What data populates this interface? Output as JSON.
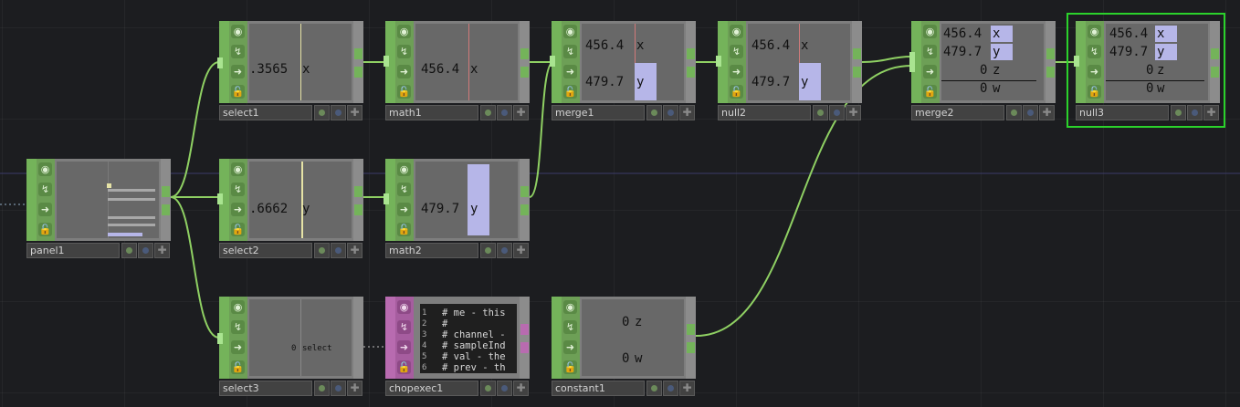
{
  "colors": {
    "background": "#1c1d20",
    "chop_node": "#74b35a",
    "dat_node": "#b86bb0",
    "wire": "#8fd063",
    "selection": "#2bd22b",
    "channel_bar": "#b6b6e8"
  },
  "node_ctrl_icons": [
    "viewer-toggle-icon",
    "bypass-icon",
    "cook-arrow-icon",
    "lock-icon"
  ],
  "nodes": {
    "select1": {
      "label": "select1",
      "value": ".3565",
      "channel": "x"
    },
    "math1": {
      "label": "math1",
      "value": "456.4",
      "channel": "x"
    },
    "merge1": {
      "label": "merge1",
      "rows": [
        {
          "value": "456.4",
          "channel": "x"
        },
        {
          "value": "479.7",
          "channel": "y"
        }
      ]
    },
    "null2": {
      "label": "null2",
      "rows": [
        {
          "value": "456.4",
          "channel": "x"
        },
        {
          "value": "479.7",
          "channel": "y"
        }
      ]
    },
    "merge2": {
      "label": "merge2",
      "rows": [
        {
          "value": "456.4",
          "channel": "x"
        },
        {
          "value": "479.7",
          "channel": "y"
        },
        {
          "value": "0",
          "channel": "z"
        },
        {
          "value": "0",
          "channel": "w"
        }
      ]
    },
    "null3": {
      "label": "null3",
      "rows": [
        {
          "value": "456.4",
          "channel": "x"
        },
        {
          "value": "479.7",
          "channel": "y"
        },
        {
          "value": "0",
          "channel": "z"
        },
        {
          "value": "0",
          "channel": "w"
        }
      ]
    },
    "panel1": {
      "label": "panel1"
    },
    "select2": {
      "label": "select2",
      "value": ".6662",
      "channel": "y"
    },
    "math2": {
      "label": "math2",
      "value": "479.7",
      "channel": "y"
    },
    "select3": {
      "label": "select3",
      "value": "0",
      "channel": "select"
    },
    "chopexec1": {
      "label": "chopexec1",
      "code": [
        {
          "n": "1",
          "text": "# me - this"
        },
        {
          "n": "2",
          "text": "#"
        },
        {
          "n": "3",
          "text": "# channel -"
        },
        {
          "n": "4",
          "text": "# sampleInd"
        },
        {
          "n": "5",
          "text": "# val - the"
        },
        {
          "n": "6",
          "text": "# prev - th"
        }
      ]
    },
    "constant1": {
      "label": "constant1",
      "rows": [
        {
          "value": "0",
          "channel": "z"
        },
        {
          "value": "0",
          "channel": "w"
        }
      ]
    }
  }
}
